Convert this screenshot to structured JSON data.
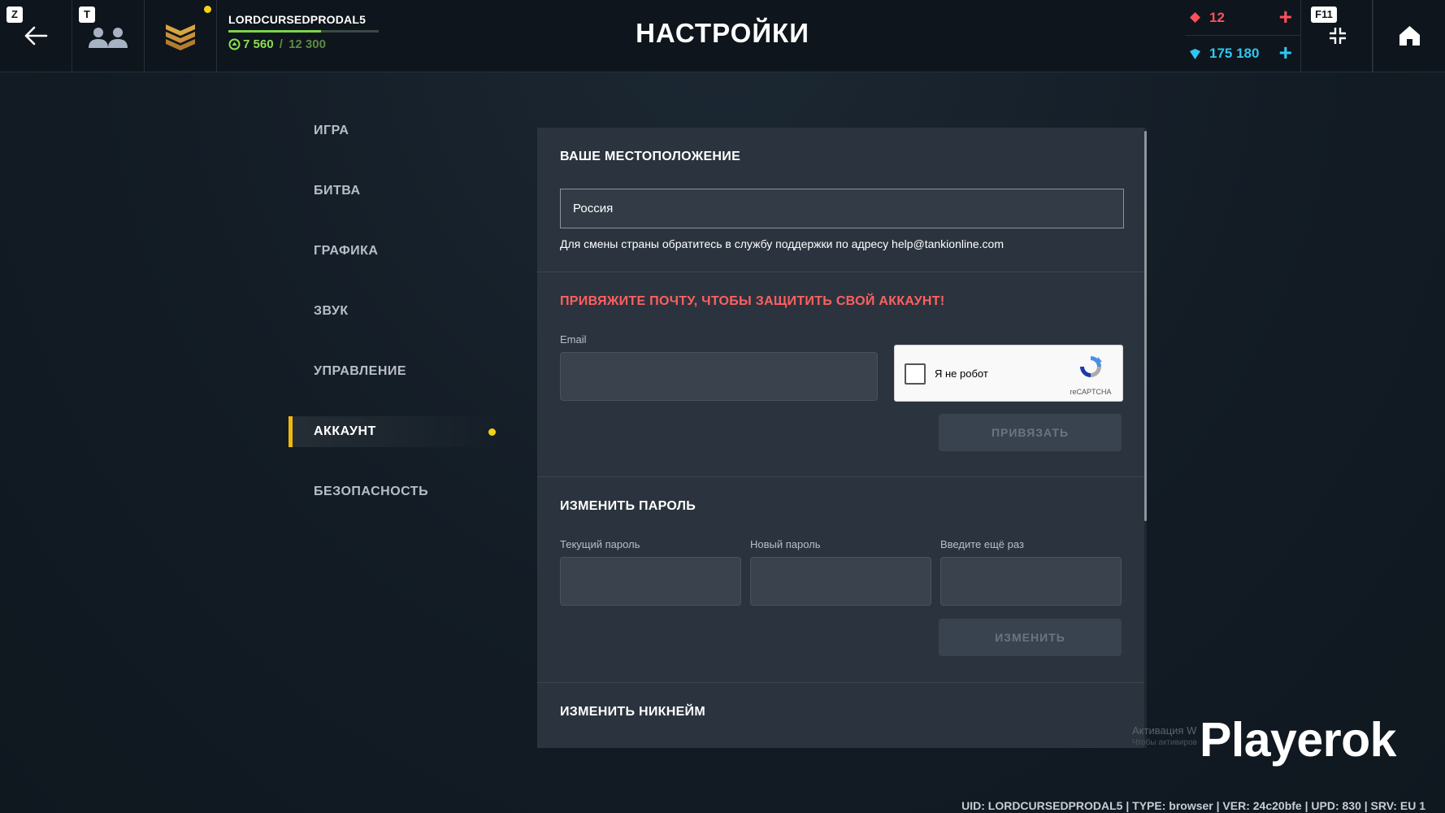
{
  "topbar": {
    "back_hotkey": "Z",
    "friends_hotkey": "T",
    "fullscreen_hotkey": "F11",
    "username": "LORDCURSEDPRODAL5",
    "xp_current": "7 560",
    "xp_sep": " / ",
    "xp_max": "12 300",
    "xp_progress": 0.6146,
    "title": "НАСТРОЙКИ",
    "crystals": "12",
    "tankoins": "175 180",
    "plus": "+"
  },
  "menu": {
    "items": [
      {
        "label": "ИГРА"
      },
      {
        "label": "БИТВА"
      },
      {
        "label": "ГРАФИКА"
      },
      {
        "label": "ЗВУК"
      },
      {
        "label": "УПРАВЛЕНИЕ"
      },
      {
        "label": "АККАУНТ"
      },
      {
        "label": "БЕЗОПАСНОСТЬ"
      }
    ],
    "active": "АККАУНТ"
  },
  "location": {
    "title": "ВАШЕ МЕСТОПОЛОЖЕНИЕ",
    "value": "Россия",
    "hint": "Для смены страны обратитесь в службу поддержки по адресу help@tankionline.com"
  },
  "email": {
    "warning": "ПРИВЯЖИТЕ ПОЧТУ, ЧТОБЫ ЗАЩИТИТЬ СВОЙ АККАУНТ!",
    "label": "Email",
    "value": "",
    "captcha_text": "Я не робот",
    "captcha_brand": "reCAPTCHA",
    "bind_button": "ПРИВЯЗАТЬ"
  },
  "password": {
    "title": "ИЗМЕНИТЬ ПАРОЛЬ",
    "current_label": "Текущий пароль",
    "new_label": "Новый пароль",
    "repeat_label": "Введите ещё раз",
    "change_button": "ИЗМЕНИТЬ"
  },
  "nickname": {
    "title": "ИЗМЕНИТЬ НИКНЕЙМ"
  },
  "overlay": {
    "watermark": "Playerok",
    "windows_activation": "Активация W",
    "windows_activation_sub": "Чтобы активиров"
  },
  "footer": {
    "info": "UID: LORDCURSEDPRODAL5 | TYPE: browser | VER: 24c20bfe | UPD: 830 | SRV: EU 1"
  },
  "colors": {
    "accent_yellow": "#f2b70f",
    "crystal_red": "#ff4f5a",
    "tankoin_cyan": "#2fc7f2",
    "xp_green": "#8be04f",
    "warning_red": "#ff6060",
    "panel_bg": "#2b343e"
  }
}
